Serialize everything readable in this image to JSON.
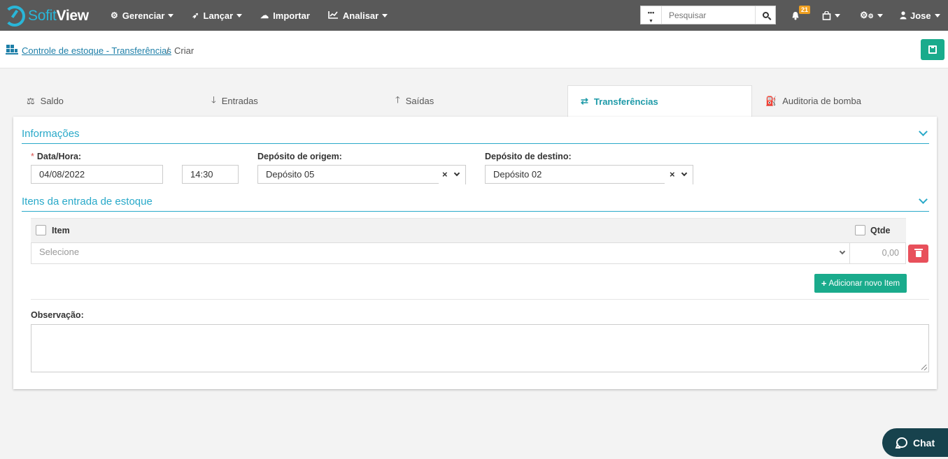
{
  "app": {
    "logo_part1": "Sofit",
    "logo_part2": "View"
  },
  "nav": {
    "items": [
      {
        "label": "Gerenciar",
        "icon": "gear-icon"
      },
      {
        "label": "Lançar",
        "icon": "rocket-icon"
      },
      {
        "label": "Importar",
        "icon": "cloud-upload-icon"
      },
      {
        "label": "Analisar",
        "icon": "line-chart-icon"
      }
    ],
    "search_placeholder": "Pesquisar",
    "search_dropdown": "•••",
    "notifications_count": "21",
    "user_name": "Jose"
  },
  "breadcrumb": {
    "link": "Controle de estoque - Transferências",
    "separator": "/",
    "current": "Criar"
  },
  "tabs": [
    {
      "label": "Saldo",
      "icon": "balance-scale-icon"
    },
    {
      "label": "Entradas",
      "icon": "arrow-down-icon"
    },
    {
      "label": "Saídas",
      "icon": "arrow-up-icon"
    },
    {
      "label": "Transferências",
      "icon": "exchange-icon",
      "active": true
    },
    {
      "label": "Auditoria de bomba",
      "icon": "fuel-pump-icon"
    }
  ],
  "info": {
    "title": "Informações",
    "date_label": "Data/Hora:",
    "required_mark": "*",
    "date_value": "04/08/2022",
    "time_value": "14:30",
    "origin_label": "Depósito de origem:",
    "origin_value": "Depósito 05",
    "dest_label": "Depósito de destino:",
    "dest_value": "Depósito 02",
    "clear_symbol": "×"
  },
  "items_section": {
    "title": "Itens da entrada de estoque",
    "col_item": "Item",
    "col_qty": "Qtde",
    "row_placeholder": "Selecione",
    "row_qty": "0,00",
    "add_button": "Adicionar novo Item",
    "add_plus": "+"
  },
  "observation": {
    "label": "Observação:"
  },
  "chat": {
    "label": "Chat"
  },
  "colors": {
    "navbar": "#595959",
    "accent": "#29a9c9",
    "save": "#1aab8c",
    "delete": "#e8505b",
    "chat": "#17424d"
  }
}
